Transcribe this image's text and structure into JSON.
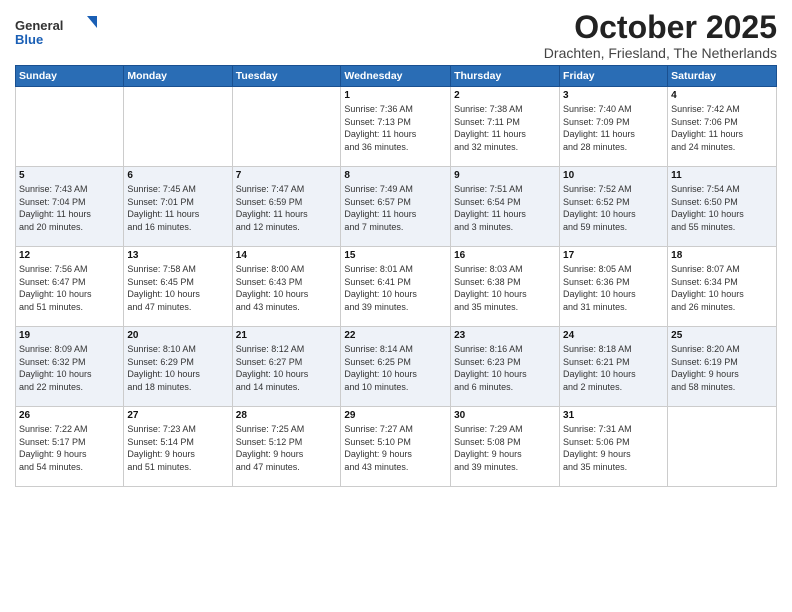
{
  "header": {
    "logo_general": "General",
    "logo_blue": "Blue",
    "month_title": "October 2025",
    "location": "Drachten, Friesland, The Netherlands"
  },
  "weekdays": [
    "Sunday",
    "Monday",
    "Tuesday",
    "Wednesday",
    "Thursday",
    "Friday",
    "Saturday"
  ],
  "weeks": [
    [
      {
        "day": "",
        "info": ""
      },
      {
        "day": "",
        "info": ""
      },
      {
        "day": "",
        "info": ""
      },
      {
        "day": "1",
        "info": "Sunrise: 7:36 AM\nSunset: 7:13 PM\nDaylight: 11 hours\nand 36 minutes."
      },
      {
        "day": "2",
        "info": "Sunrise: 7:38 AM\nSunset: 7:11 PM\nDaylight: 11 hours\nand 32 minutes."
      },
      {
        "day": "3",
        "info": "Sunrise: 7:40 AM\nSunset: 7:09 PM\nDaylight: 11 hours\nand 28 minutes."
      },
      {
        "day": "4",
        "info": "Sunrise: 7:42 AM\nSunset: 7:06 PM\nDaylight: 11 hours\nand 24 minutes."
      }
    ],
    [
      {
        "day": "5",
        "info": "Sunrise: 7:43 AM\nSunset: 7:04 PM\nDaylight: 11 hours\nand 20 minutes."
      },
      {
        "day": "6",
        "info": "Sunrise: 7:45 AM\nSunset: 7:01 PM\nDaylight: 11 hours\nand 16 minutes."
      },
      {
        "day": "7",
        "info": "Sunrise: 7:47 AM\nSunset: 6:59 PM\nDaylight: 11 hours\nand 12 minutes."
      },
      {
        "day": "8",
        "info": "Sunrise: 7:49 AM\nSunset: 6:57 PM\nDaylight: 11 hours\nand 7 minutes."
      },
      {
        "day": "9",
        "info": "Sunrise: 7:51 AM\nSunset: 6:54 PM\nDaylight: 11 hours\nand 3 minutes."
      },
      {
        "day": "10",
        "info": "Sunrise: 7:52 AM\nSunset: 6:52 PM\nDaylight: 10 hours\nand 59 minutes."
      },
      {
        "day": "11",
        "info": "Sunrise: 7:54 AM\nSunset: 6:50 PM\nDaylight: 10 hours\nand 55 minutes."
      }
    ],
    [
      {
        "day": "12",
        "info": "Sunrise: 7:56 AM\nSunset: 6:47 PM\nDaylight: 10 hours\nand 51 minutes."
      },
      {
        "day": "13",
        "info": "Sunrise: 7:58 AM\nSunset: 6:45 PM\nDaylight: 10 hours\nand 47 minutes."
      },
      {
        "day": "14",
        "info": "Sunrise: 8:00 AM\nSunset: 6:43 PM\nDaylight: 10 hours\nand 43 minutes."
      },
      {
        "day": "15",
        "info": "Sunrise: 8:01 AM\nSunset: 6:41 PM\nDaylight: 10 hours\nand 39 minutes."
      },
      {
        "day": "16",
        "info": "Sunrise: 8:03 AM\nSunset: 6:38 PM\nDaylight: 10 hours\nand 35 minutes."
      },
      {
        "day": "17",
        "info": "Sunrise: 8:05 AM\nSunset: 6:36 PM\nDaylight: 10 hours\nand 31 minutes."
      },
      {
        "day": "18",
        "info": "Sunrise: 8:07 AM\nSunset: 6:34 PM\nDaylight: 10 hours\nand 26 minutes."
      }
    ],
    [
      {
        "day": "19",
        "info": "Sunrise: 8:09 AM\nSunset: 6:32 PM\nDaylight: 10 hours\nand 22 minutes."
      },
      {
        "day": "20",
        "info": "Sunrise: 8:10 AM\nSunset: 6:29 PM\nDaylight: 10 hours\nand 18 minutes."
      },
      {
        "day": "21",
        "info": "Sunrise: 8:12 AM\nSunset: 6:27 PM\nDaylight: 10 hours\nand 14 minutes."
      },
      {
        "day": "22",
        "info": "Sunrise: 8:14 AM\nSunset: 6:25 PM\nDaylight: 10 hours\nand 10 minutes."
      },
      {
        "day": "23",
        "info": "Sunrise: 8:16 AM\nSunset: 6:23 PM\nDaylight: 10 hours\nand 6 minutes."
      },
      {
        "day": "24",
        "info": "Sunrise: 8:18 AM\nSunset: 6:21 PM\nDaylight: 10 hours\nand 2 minutes."
      },
      {
        "day": "25",
        "info": "Sunrise: 8:20 AM\nSunset: 6:19 PM\nDaylight: 9 hours\nand 58 minutes."
      }
    ],
    [
      {
        "day": "26",
        "info": "Sunrise: 7:22 AM\nSunset: 5:17 PM\nDaylight: 9 hours\nand 54 minutes."
      },
      {
        "day": "27",
        "info": "Sunrise: 7:23 AM\nSunset: 5:14 PM\nDaylight: 9 hours\nand 51 minutes."
      },
      {
        "day": "28",
        "info": "Sunrise: 7:25 AM\nSunset: 5:12 PM\nDaylight: 9 hours\nand 47 minutes."
      },
      {
        "day": "29",
        "info": "Sunrise: 7:27 AM\nSunset: 5:10 PM\nDaylight: 9 hours\nand 43 minutes."
      },
      {
        "day": "30",
        "info": "Sunrise: 7:29 AM\nSunset: 5:08 PM\nDaylight: 9 hours\nand 39 minutes."
      },
      {
        "day": "31",
        "info": "Sunrise: 7:31 AM\nSunset: 5:06 PM\nDaylight: 9 hours\nand 35 minutes."
      },
      {
        "day": "",
        "info": ""
      }
    ]
  ]
}
